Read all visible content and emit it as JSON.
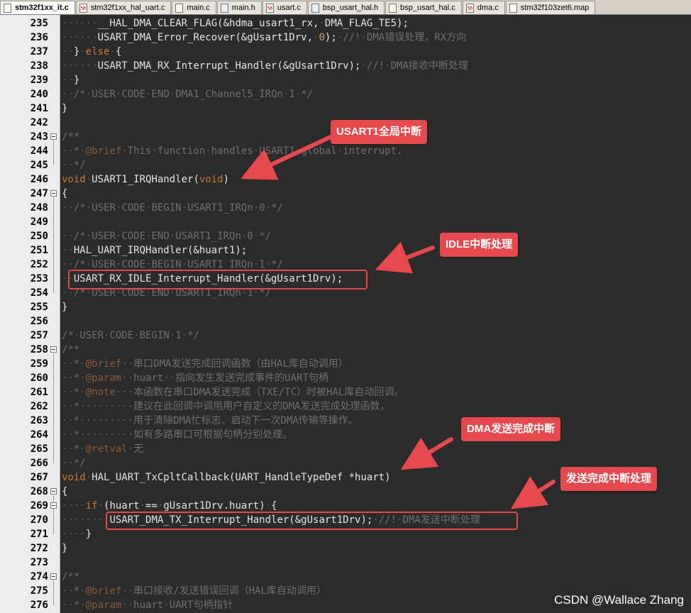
{
  "tabs": [
    {
      "label": "stm32f1xx_it.c",
      "type": "c",
      "active": true,
      "modified": false
    },
    {
      "label": "stm32f1xx_hal_uart.c",
      "type": "c",
      "active": false,
      "modified": true
    },
    {
      "label": "main.c",
      "type": "c",
      "active": false,
      "modified": false
    },
    {
      "label": "main.h",
      "type": "h",
      "active": false,
      "modified": false
    },
    {
      "label": "usart.c",
      "type": "c",
      "active": false,
      "modified": true
    },
    {
      "label": "bsp_usart_hal.h",
      "type": "h",
      "active": false,
      "modified": false
    },
    {
      "label": "bsp_usart_hal.c",
      "type": "c",
      "active": false,
      "modified": false
    },
    {
      "label": "dma.c",
      "type": "c",
      "active": false,
      "modified": true
    },
    {
      "label": "stm32f103zet6.map",
      "type": "map",
      "active": false,
      "modified": false
    }
  ],
  "lines": [
    {
      "n": "235",
      "fold": false,
      "html": "<span class='ws'>······</span>__HAL_DMA_CLEAR_FLAG(&amp;hdma_usart1_rx,<span class='ws'>·</span>DMA_FLAG_TE5);"
    },
    {
      "n": "236",
      "fold": false,
      "html": "<span class='ws'>······</span>USART_DMA_Error_Recover(&amp;gUsart1Drv,<span class='ws'>·</span><span class='num'>0</span>);<span class='ws'>·</span><span class='cm'>//!<span class='ws'>·</span>DMA错误处理，RX方向</span>"
    },
    {
      "n": "237",
      "fold": false,
      "html": "<span class='ws'>··</span>}<span class='ws'>·</span><span class='kw'>else</span><span class='ws'>·</span>{"
    },
    {
      "n": "238",
      "fold": false,
      "html": "<span class='ws'>······</span>USART_DMA_RX_Interrupt_Handler(&amp;gUsart1Drv);<span class='ws'>·</span><span class='cm'>//!<span class='ws'>·</span>DMA接收中断处理</span>"
    },
    {
      "n": "239",
      "fold": false,
      "html": "<span class='ws'>··</span>}"
    },
    {
      "n": "240",
      "fold": false,
      "html": "<span class='ws'>··</span><span class='cm'>/*<span class='ws'>·</span>USER<span class='ws'>·</span>CODE<span class='ws'>·</span>END<span class='ws'>·</span>DMA1_Channel5_IRQn<span class='ws'>·</span>1<span class='ws'>·</span>*/</span>"
    },
    {
      "n": "241",
      "fold": false,
      "html": "}"
    },
    {
      "n": "242",
      "fold": false,
      "html": ""
    },
    {
      "n": "243",
      "fold": true,
      "html": "<span class='cm'>/**</span>"
    },
    {
      "n": "244",
      "fold": false,
      "html": "<span class='cm'><span class='ws'>··</span>*<span class='ws'>·</span><span class='cmk'>@brief</span><span class='ws'>·</span>This<span class='ws'>·</span>function<span class='ws'>·</span>handles<span class='ws'>·</span>USART1<span class='ws'>·</span>global<span class='ws'>·</span>interrupt.</span>"
    },
    {
      "n": "245",
      "fold": false,
      "html": "<span class='cm'><span class='ws'>··</span>*/</span>"
    },
    {
      "n": "246",
      "fold": false,
      "html": "<span class='kw'>void</span><span class='ws'>·</span>USART1_IRQHandler(<span class='kw'>void</span>)"
    },
    {
      "n": "247",
      "fold": true,
      "html": "{"
    },
    {
      "n": "248",
      "fold": false,
      "html": "<span class='ws'>··</span><span class='cm'>/*<span class='ws'>·</span>USER<span class='ws'>·</span>CODE<span class='ws'>·</span>BEGIN<span class='ws'>·</span>USART1_IRQn<span class='ws'>·</span>0<span class='ws'>·</span>*/</span>"
    },
    {
      "n": "249",
      "fold": false,
      "html": ""
    },
    {
      "n": "250",
      "fold": false,
      "html": "<span class='ws'>··</span><span class='cm'>/*<span class='ws'>·</span>USER<span class='ws'>·</span>CODE<span class='ws'>·</span>END<span class='ws'>·</span>USART1_IRQn<span class='ws'>·</span>0<span class='ws'>·</span>*/</span>"
    },
    {
      "n": "251",
      "fold": false,
      "html": "<span class='ws'>··</span>HAL_UART_IRQHandler(&amp;huart1);"
    },
    {
      "n": "252",
      "fold": false,
      "html": "<span class='ws'>··</span><span class='cm'>/*<span class='ws'>·</span>USER<span class='ws'>·</span>CODE<span class='ws'>·</span>BEGIN<span class='ws'>·</span>USART1_IRQn<span class='ws'>·</span>1<span class='ws'>·</span>*/</span>"
    },
    {
      "n": "253",
      "fold": false,
      "html": "<span class='ws'>··</span>USART_RX_IDLE_Interrupt_Handler(&amp;gUsart1Drv);"
    },
    {
      "n": "254",
      "fold": false,
      "html": "<span class='ws'>··</span><span class='cm'>/*<span class='ws'>·</span>USER<span class='ws'>·</span>CODE<span class='ws'>·</span>END<span class='ws'>·</span>USART1_IRQn<span class='ws'>·</span>1<span class='ws'>·</span>*/</span>"
    },
    {
      "n": "255",
      "fold": false,
      "html": "}"
    },
    {
      "n": "256",
      "fold": false,
      "html": ""
    },
    {
      "n": "257",
      "fold": false,
      "html": "<span class='cm'>/*<span class='ws'>·</span>USER<span class='ws'>·</span>CODE<span class='ws'>·</span>BEGIN<span class='ws'>·</span>1<span class='ws'>·</span>*/</span>"
    },
    {
      "n": "258",
      "fold": true,
      "html": "<span class='cm'>/**</span>"
    },
    {
      "n": "259",
      "fold": false,
      "html": "<span class='cm'><span class='ws'>··</span>*<span class='ws'>·</span><span class='cmk'>@brief</span><span class='ws'>··</span>串口DMA发送完成回调函数（由HAL库自动调用）</span>"
    },
    {
      "n": "260",
      "fold": false,
      "html": "<span class='cm'><span class='ws'>··</span>*<span class='ws'>·</span><span class='cmk'>@param</span><span class='ws'>··</span>huart<span class='ws'>··</span>指向发生发送完成事件的UART句柄</span>"
    },
    {
      "n": "261",
      "fold": false,
      "html": "<span class='cm'><span class='ws'>··</span>*<span class='ws'>·</span><span class='cmk'>@note</span><span class='ws'>···</span>本函数在串口DMA发送完成（TXE/TC）时被HAL库自动回调。</span>"
    },
    {
      "n": "262",
      "fold": false,
      "html": "<span class='cm'><span class='ws'>··</span>*<span class='ws'>·········</span>建议在此回调中调用用户自定义的DMA发送完成处理函数，</span>"
    },
    {
      "n": "263",
      "fold": false,
      "html": "<span class='cm'><span class='ws'>··</span>*<span class='ws'>·········</span>用于清除DMA忙标志、启动下一次DMA传输等操作。</span>"
    },
    {
      "n": "264",
      "fold": false,
      "html": "<span class='cm'><span class='ws'>··</span>*<span class='ws'>·········</span>如有多路串口可根据句柄分别处理。</span>"
    },
    {
      "n": "265",
      "fold": false,
      "html": "<span class='cm'><span class='ws'>··</span>*<span class='ws'>·</span><span class='cmk'>@retval</span><span class='ws'>·</span>无</span>"
    },
    {
      "n": "266",
      "fold": false,
      "html": "<span class='cm'><span class='ws'>··</span>*/</span>"
    },
    {
      "n": "267",
      "fold": false,
      "html": "<span class='kw'>void</span><span class='ws'>·</span>HAL_UART_TxCpltCallback(UART_HandleTypeDef<span class='ws'>·</span>*huart)"
    },
    {
      "n": "268",
      "fold": true,
      "html": "{"
    },
    {
      "n": "269",
      "fold": true,
      "html": "<span class='ws'>····</span><span class='kw'>if</span><span class='ws'>·</span>(huart<span class='ws'>·</span>==<span class='ws'>·</span>gUsart1Drv.huart)<span class='ws'>·</span>{"
    },
    {
      "n": "270",
      "fold": false,
      "html": "<span class='ws'>········</span>USART_DMA_TX_Interrupt_Handler(&amp;gUsart1Drv);<span class='ws'>·</span><span class='cm'>//!<span class='ws'>·</span>DMA发送中断处理</span>"
    },
    {
      "n": "271",
      "fold": false,
      "html": "<span class='ws'>····</span>}"
    },
    {
      "n": "272",
      "fold": false,
      "html": "}"
    },
    {
      "n": "273",
      "fold": false,
      "html": ""
    },
    {
      "n": "274",
      "fold": true,
      "html": "<span class='cm'>/**</span>"
    },
    {
      "n": "275",
      "fold": false,
      "html": "<span class='cm'><span class='ws'>··</span>*<span class='ws'>·</span><span class='cmk'>@brief</span><span class='ws'>··</span>串口接收/发送错误回调（HAL库自动调用）</span>"
    },
    {
      "n": "276",
      "fold": false,
      "html": "<span class='cm'><span class='ws'>··</span>*<span class='ws'>·</span><span class='cmk'>@param</span><span class='ws'>··</span>huart<span class='ws'>·</span>UART句柄指针</span>"
    }
  ],
  "annotations": {
    "usart1_irq": "USART1全局中断",
    "idle_handler": "IDLE中断处理",
    "dma_tx_complete": "DMA发送完成中断",
    "tx_complete_handler": "发送完成中断处理"
  },
  "watermark": "CSDN @Wallace Zhang",
  "colors": {
    "editor_bg": "#2b2b2b",
    "annotation_red": "#e5484d",
    "keyword": "#cc7832",
    "comment": "#707070"
  }
}
